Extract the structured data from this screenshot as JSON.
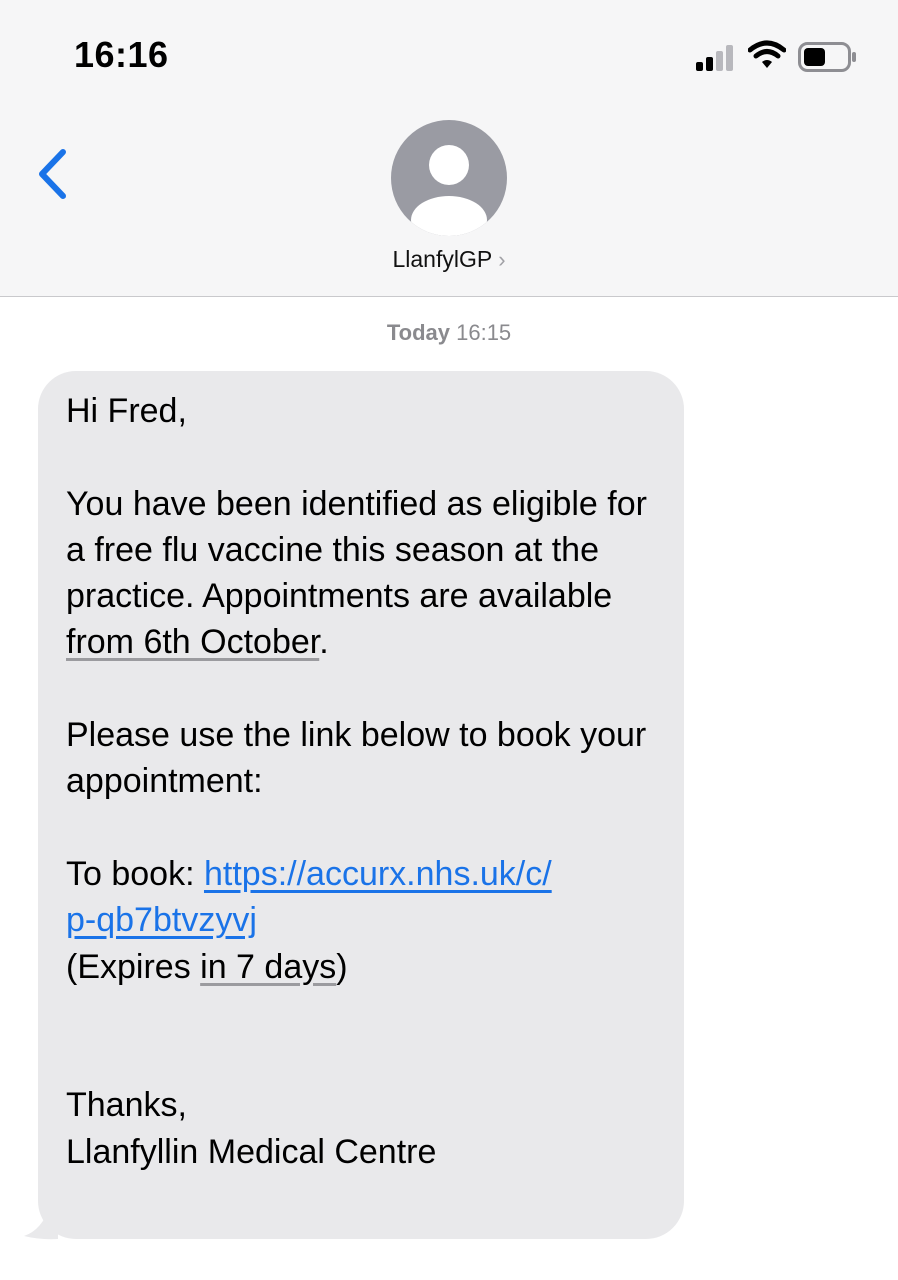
{
  "status_bar": {
    "time": "16:16",
    "icons": [
      "signal-icon",
      "wifi-icon",
      "battery-icon"
    ],
    "battery_level": 0.5
  },
  "nav": {
    "back_icon": "chevron-left-icon",
    "avatar_icon": "person-placeholder-icon",
    "contact_name": "LlanfylGP",
    "contact_chevron": "›"
  },
  "thread": {
    "timestamp_day": "Today",
    "timestamp_time": "16:15"
  },
  "message": {
    "greeting": "Hi Fred,",
    "body_lead": "You have been identified as eligible for a free flu vaccine this season at the practice. Appointments are available ",
    "date_link": "from 6th October",
    "body_end": ".",
    "instruction": "Please use the link below to book your appointment:",
    "book_label": "To book: ",
    "url_line1": "https://accurx.nhs.uk/c/",
    "url_line2": "p-qb7btvzyvj",
    "expires_open": "(Expires ",
    "expires_link": "in 7 days",
    "expires_close": ")",
    "signoff": "Thanks,",
    "signature": "Llanfyllin Medical Centre"
  },
  "colors": {
    "accent": "#1a73e8",
    "bubble_bg": "#e9e9eb",
    "header_bg": "#f6f6f7",
    "timestamp": "#8a8a8e",
    "avatar": "#9a9ba3"
  }
}
